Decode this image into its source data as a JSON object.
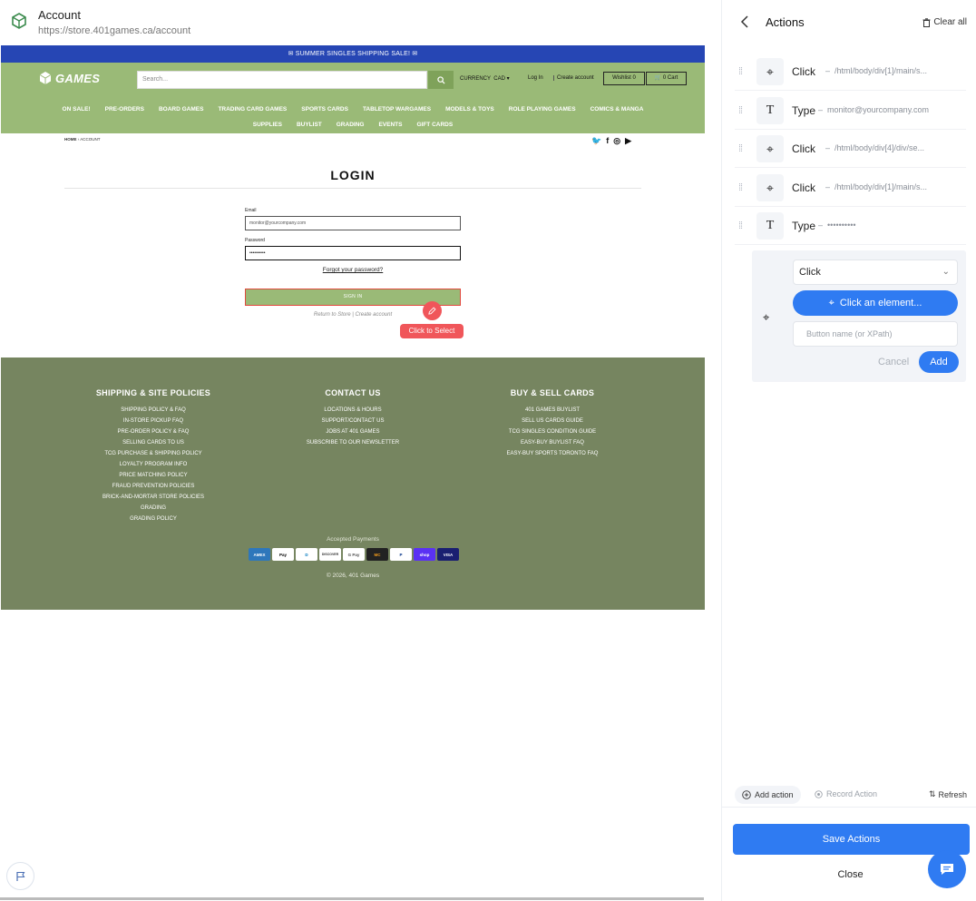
{
  "header": {
    "title": "Account",
    "url": "https://store.401games.ca/account"
  },
  "site": {
    "announcement": "✉ SUMMER SINGLES SHIPPING SALE! ✉",
    "brand": "GAMES",
    "search_placeholder": "Search...",
    "currency_label": "CURRENCY",
    "currency_value": "CAD",
    "login_link": "Log In",
    "create_link": "Create account",
    "wishlist": "Wishlist 0",
    "cart": "0 Cart",
    "nav_row1": [
      "ON SALE!",
      "PRE-ORDERS",
      "BOARD GAMES",
      "TRADING CARD GAMES",
      "SPORTS CARDS",
      "TABLETOP WARGAMES",
      "MODELS & TOYS",
      "ROLE PLAYING GAMES",
      "COMICS & MANGA"
    ],
    "nav_row2": [
      "SUPPLIES",
      "BUYLIST",
      "GRADING",
      "EVENTS",
      "GIFT CARDS"
    ],
    "breadcrumb_home": "HOME",
    "breadcrumb_sep": "›",
    "breadcrumb_current": "ACCOUNT",
    "login_title": "LOGIN",
    "email_label": "Email",
    "email_value": "monitor@yourcompany.com",
    "password_label": "Password",
    "password_value": "••••••••••",
    "forgot": "Forgot your password?",
    "signin": "SIGN IN",
    "return_text": "Return to Store | Create account",
    "tooltip": "Click to Select",
    "footer_cols": [
      {
        "heading": "SHIPPING & SITE POLICIES",
        "links": [
          "SHIPPING POLICY & FAQ",
          "IN-STORE PICKUP FAQ",
          "PRE-ORDER POLICY & FAQ",
          "SELLING CARDS TO US",
          "TCG PURCHASE & SHIPPING POLICY",
          "LOYALTY PROGRAM INFO",
          "PRICE MATCHING POLICY",
          "FRAUD PREVENTION POLICIES",
          "BRICK-AND-MORTAR STORE POLICIES",
          "GRADING",
          "GRADING POLICY"
        ]
      },
      {
        "heading": "CONTACT US",
        "links": [
          "LOCATIONS & HOURS",
          "SUPPORT/CONTACT US",
          "JOBS AT 401 GAMES",
          "SUBSCRIBE TO OUR NEWSLETTER"
        ]
      },
      {
        "heading": "BUY & SELL CARDS",
        "links": [
          "401 GAMES BUYLIST",
          "SELL US CARDS GUIDE",
          "TCG SINGLES CONDITION GUIDE",
          "EASY-BUY BUYLIST FAQ",
          "EASY-BUY SPORTS TORONTO FAQ"
        ]
      }
    ],
    "accepted": "Accepted Payments",
    "payments": [
      "AMEX",
      "Pay",
      "D",
      "DISCOVER",
      "G Pay",
      "MC",
      "P",
      "shop",
      "VISA"
    ],
    "copyright": "© 2026, 401 Games"
  },
  "panel": {
    "title": "Actions",
    "clear_all": "Clear all",
    "actions": [
      {
        "type": "Click",
        "detail": "/html/body/div[1]/main/s..."
      },
      {
        "type": "Type",
        "detail": "monitor@yourcompany.com"
      },
      {
        "type": "Click",
        "detail": "/html/body/div[4]/div/se..."
      },
      {
        "type": "Click",
        "detail": "/html/body/div[1]/main/s..."
      },
      {
        "type": "Type",
        "detail": "••••••••••"
      }
    ],
    "new_action": {
      "select_value": "Click",
      "click_element": "Click an element...",
      "input_placeholder": "Button name (or XPath)",
      "cancel": "Cancel",
      "add": "Add"
    },
    "add_action": "Add action",
    "record_action": "Record Action",
    "refresh": "Refresh",
    "save": "Save Actions",
    "close": "Close"
  },
  "colors": {
    "accent": "#2f7bf2",
    "site_green": "#9aba77",
    "footer_green": "#768560",
    "highlight_red": "#f0565a"
  }
}
